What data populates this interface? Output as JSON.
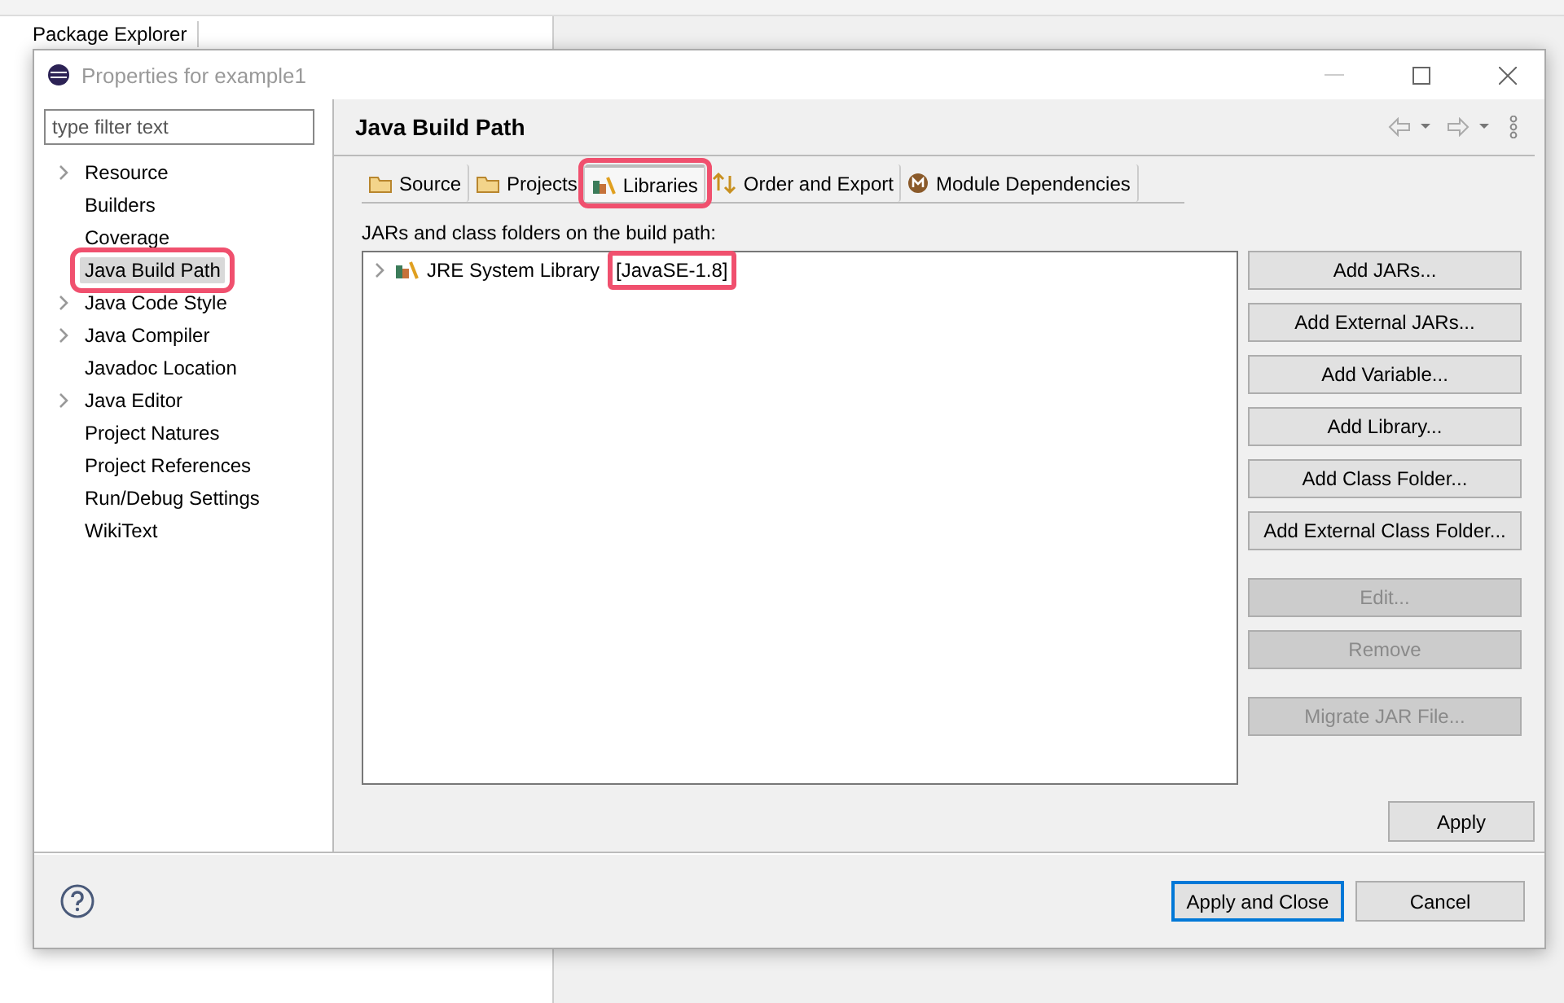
{
  "workbench": {
    "view_tab": "Package Explorer"
  },
  "dialog": {
    "title": "Properties for example1"
  },
  "filter": {
    "placeholder": "type filter text"
  },
  "tree": [
    {
      "label": "Resource",
      "has_children": true,
      "selected": false,
      "highlighted": false
    },
    {
      "label": "Builders",
      "has_children": false,
      "selected": false,
      "highlighted": false
    },
    {
      "label": "Coverage",
      "has_children": false,
      "selected": false,
      "highlighted": false
    },
    {
      "label": "Java Build Path",
      "has_children": false,
      "selected": true,
      "highlighted": true
    },
    {
      "label": "Java Code Style",
      "has_children": true,
      "selected": false,
      "highlighted": false
    },
    {
      "label": "Java Compiler",
      "has_children": true,
      "selected": false,
      "highlighted": false
    },
    {
      "label": "Javadoc Location",
      "has_children": false,
      "selected": false,
      "highlighted": false
    },
    {
      "label": "Java Editor",
      "has_children": true,
      "selected": false,
      "highlighted": false
    },
    {
      "label": "Project Natures",
      "has_children": false,
      "selected": false,
      "highlighted": false
    },
    {
      "label": "Project References",
      "has_children": false,
      "selected": false,
      "highlighted": false
    },
    {
      "label": "Run/Debug Settings",
      "has_children": false,
      "selected": false,
      "highlighted": false
    },
    {
      "label": "WikiText",
      "has_children": false,
      "selected": false,
      "highlighted": false
    }
  ],
  "page": {
    "title": "Java Build Path"
  },
  "tabs": [
    {
      "label": "Source",
      "kind": "folder",
      "selected": false,
      "highlighted": false
    },
    {
      "label": "Projects",
      "kind": "folder",
      "selected": false,
      "highlighted": false
    },
    {
      "label": "Libraries",
      "kind": "books",
      "selected": true,
      "highlighted": true
    },
    {
      "label": "Order and Export",
      "kind": "arrows",
      "selected": false,
      "highlighted": false
    },
    {
      "label": "Module Dependencies",
      "kind": "module",
      "selected": false,
      "highlighted": false
    }
  ],
  "list_label": "JARs and class folders on the build path:",
  "entries": [
    {
      "name": "JRE System Library",
      "version": "[JavaSE-1.8]",
      "expanded": false,
      "version_highlighted": true
    }
  ],
  "button_groups": [
    [
      {
        "label": "Add JARs...",
        "disabled": false
      },
      {
        "label": "Add External JARs...",
        "disabled": false
      },
      {
        "label": "Add Variable...",
        "disabled": false
      },
      {
        "label": "Add Library...",
        "disabled": false
      },
      {
        "label": "Add Class Folder...",
        "disabled": false
      },
      {
        "label": "Add External Class Folder...",
        "disabled": false
      }
    ],
    [
      {
        "label": "Edit...",
        "disabled": true
      },
      {
        "label": "Remove",
        "disabled": true
      }
    ],
    [
      {
        "label": "Migrate JAR File...",
        "disabled": true
      }
    ]
  ],
  "apply_button": "Apply",
  "footer_buttons": [
    {
      "label": "Apply and Close",
      "default": true
    },
    {
      "label": "Cancel",
      "default": false
    }
  ]
}
